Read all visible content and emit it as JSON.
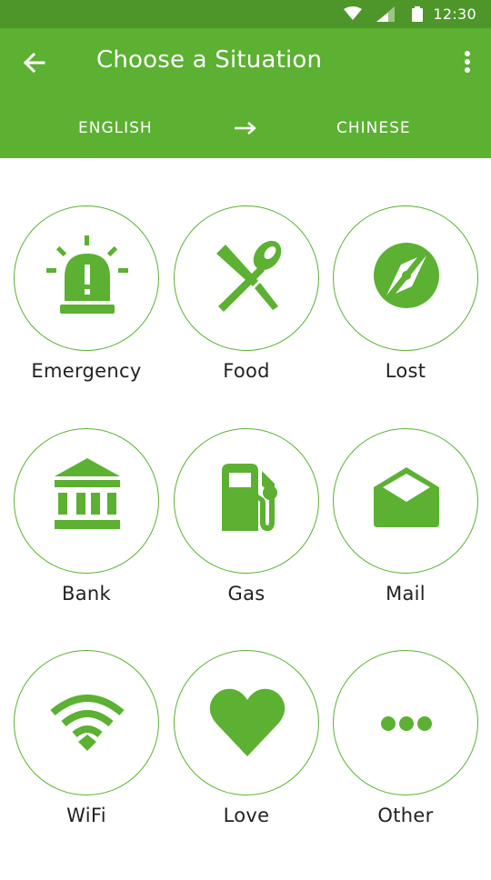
{
  "status_bar": {
    "time": "12:30"
  },
  "header": {
    "title": "Choose a Situation"
  },
  "languages": {
    "from": "ENGLISH",
    "to": "CHINESE"
  },
  "colors": {
    "brand": "#5cb032",
    "status_bar": "#4e962a",
    "label": "#222222"
  },
  "situations": [
    {
      "label": "Emergency",
      "icon": "siren-icon"
    },
    {
      "label": "Food",
      "icon": "fork-spoon-icon"
    },
    {
      "label": "Lost",
      "icon": "compass-icon"
    },
    {
      "label": "Bank",
      "icon": "bank-icon"
    },
    {
      "label": "Gas",
      "icon": "gas-pump-icon"
    },
    {
      "label": "Mail",
      "icon": "mail-icon"
    },
    {
      "label": "WiFi",
      "icon": "wifi-icon"
    },
    {
      "label": "Love",
      "icon": "heart-icon"
    },
    {
      "label": "Other",
      "icon": "more-horizontal-icon"
    }
  ]
}
